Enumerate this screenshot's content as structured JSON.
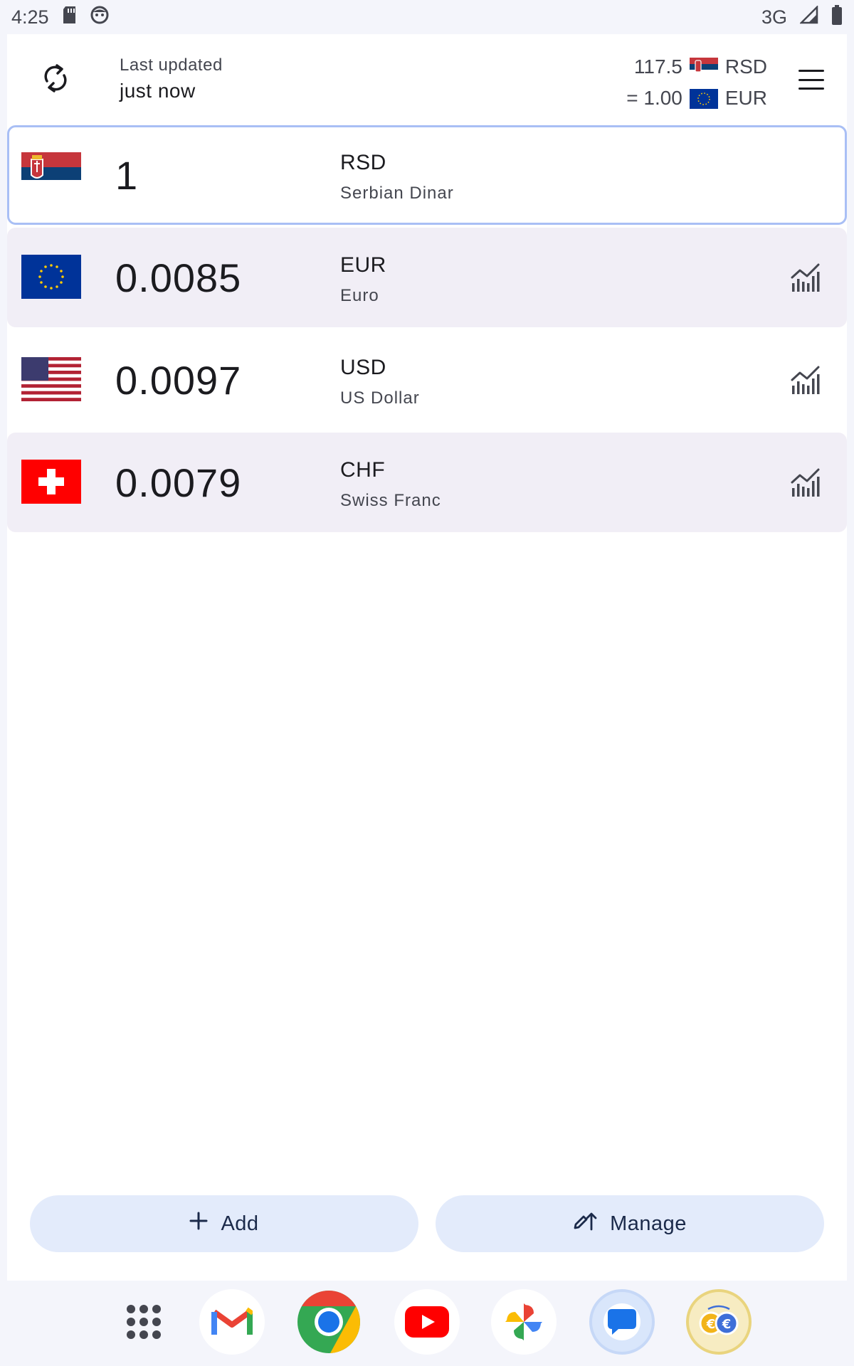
{
  "status_bar": {
    "time": "4:25",
    "network": "3G",
    "icons": [
      "sd-card-icon",
      "face-icon",
      "signal-icon",
      "battery-icon"
    ]
  },
  "header": {
    "updated_label": "Last updated",
    "updated_value": "just now",
    "rate_top_value": "117.5",
    "rate_top_code": "RSD",
    "rate_bottom_value": "= 1.00",
    "rate_bottom_code": "EUR",
    "icons": [
      "refresh-icon",
      "menu-icon"
    ]
  },
  "currencies": [
    {
      "code": "RSD",
      "name": "Serbian Dinar",
      "amount": "1",
      "flag": "serbia-flag",
      "base": true
    },
    {
      "code": "EUR",
      "name": "Euro",
      "amount": "0.0085",
      "flag": "eu-flag",
      "base": false
    },
    {
      "code": "USD",
      "name": "US Dollar",
      "amount": "0.0097",
      "flag": "us-flag",
      "base": false
    },
    {
      "code": "CHF",
      "name": "Swiss Franc",
      "amount": "0.0079",
      "flag": "swiss-flag",
      "base": false
    }
  ],
  "actions": {
    "add_label": "Add",
    "manage_label": "Manage"
  },
  "dock": [
    "apps-icon",
    "gmail-icon",
    "chrome-icon",
    "youtube-icon",
    "photos-icon",
    "messages-icon",
    "currency-converter-icon"
  ],
  "colors": {
    "accent": "#a9bff5",
    "row_alt": "#f1eef6",
    "pill": "#e3ebfb"
  }
}
